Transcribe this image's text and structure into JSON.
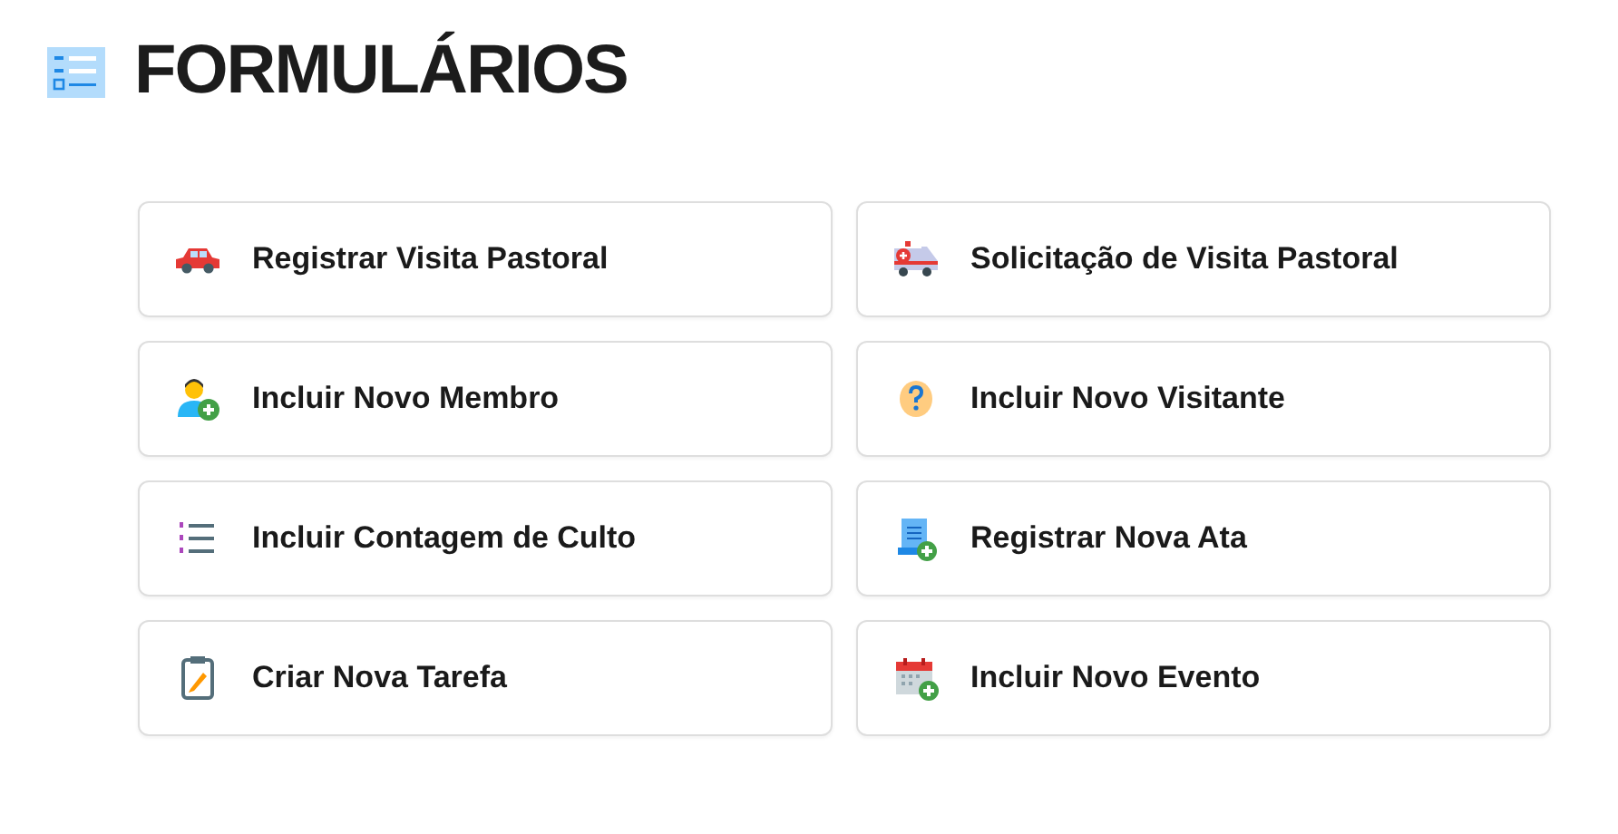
{
  "title": "FORMULÁRIOS",
  "forms": [
    {
      "label": "Registrar Visita Pastoral",
      "kind": "car"
    },
    {
      "label": "Solicitação de Visita Pastoral",
      "kind": "ambulance"
    },
    {
      "label": "Incluir Novo Membro",
      "kind": "person-add"
    },
    {
      "label": "Incluir Novo Visitante",
      "kind": "question"
    },
    {
      "label": "Incluir Contagem de Culto",
      "kind": "list"
    },
    {
      "label": "Registrar Nova Ata",
      "kind": "document-add"
    },
    {
      "label": "Criar Nova Tarefa",
      "kind": "clipboard"
    },
    {
      "label": "Incluir Novo Evento",
      "kind": "calendar-add"
    }
  ]
}
